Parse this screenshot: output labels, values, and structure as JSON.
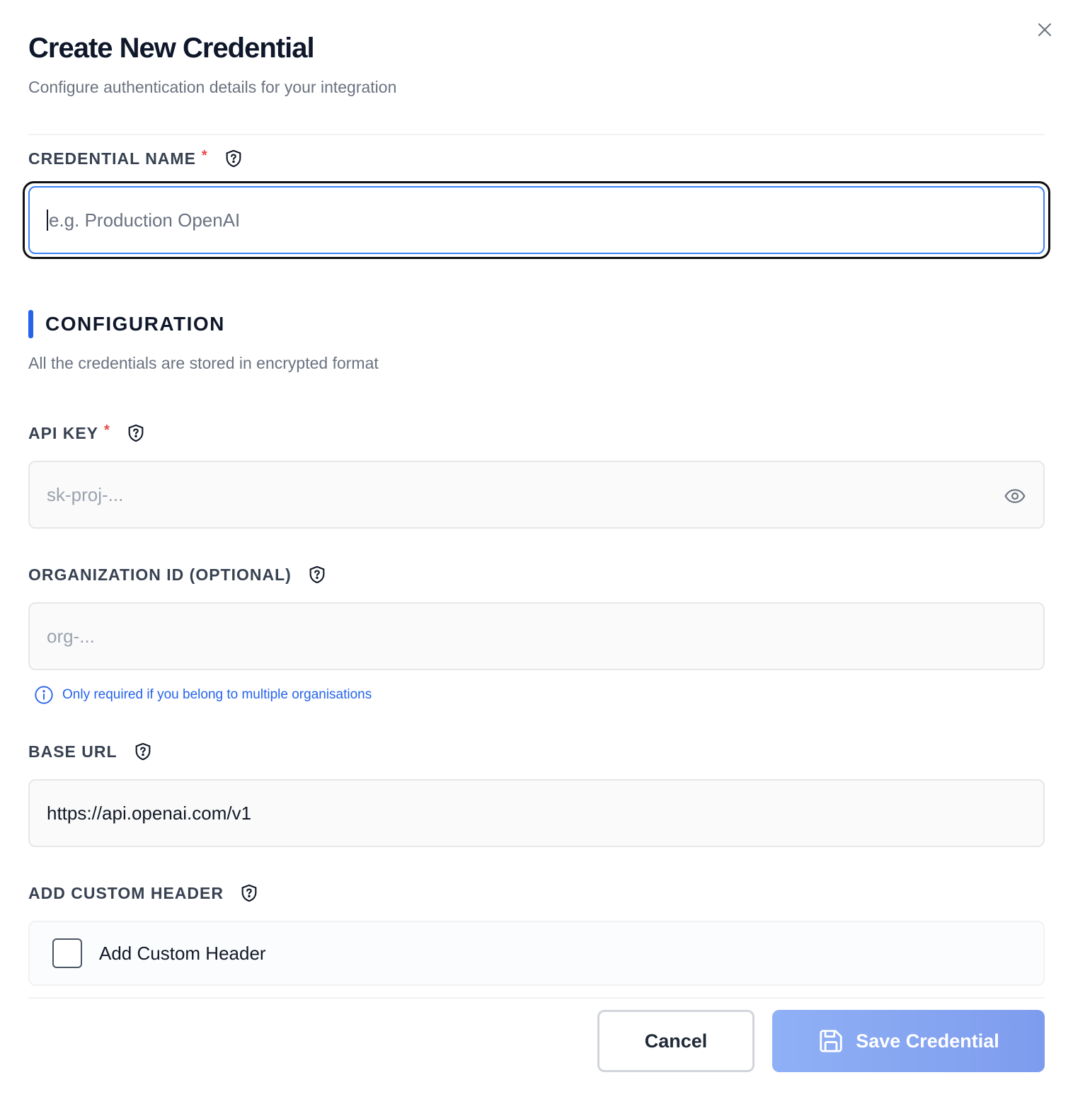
{
  "dialog": {
    "title": "Create New Credential",
    "subtitle": "Configure authentication details for your integration",
    "close_icon": "close-icon"
  },
  "credential_name": {
    "label": "CREDENTIAL NAME",
    "required_mark": "*",
    "placeholder": "e.g. Production OpenAI",
    "value": ""
  },
  "configuration": {
    "title": "CONFIGURATION",
    "description": "All the credentials are stored in encrypted format"
  },
  "api_key": {
    "label": "API KEY",
    "required_mark": "*",
    "placeholder": "sk-proj-...",
    "value": ""
  },
  "organization_id": {
    "label": "ORGANIZATION ID (OPTIONAL)",
    "placeholder": "org-...",
    "value": "",
    "hint": "Only required if you belong to multiple organisations"
  },
  "base_url": {
    "label": "BASE URL",
    "value": "https://api.openai.com/v1"
  },
  "custom_header": {
    "label": "ADD CUSTOM HEADER",
    "checkbox_label": "Add Custom Header",
    "checked": false
  },
  "footer": {
    "cancel_label": "Cancel",
    "save_label": "Save Credential"
  },
  "colors": {
    "accent": "#2563eb",
    "required": "#ef4444",
    "save_button": "#8fb0f6"
  }
}
